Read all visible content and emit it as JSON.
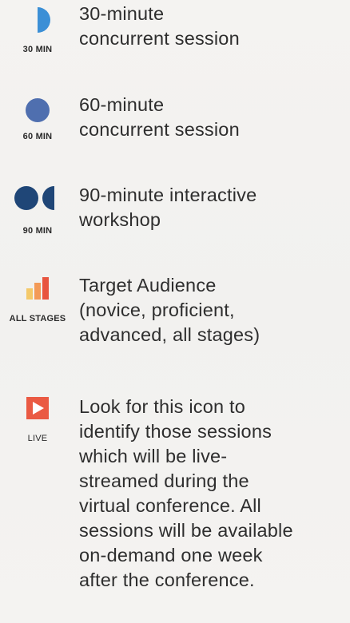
{
  "legend": {
    "session_30": {
      "icon": "half-circle-icon",
      "label": "30 MIN",
      "lines": [
        "30-minute",
        "concurrent session"
      ],
      "color": "#3b8fd6"
    },
    "session_60": {
      "icon": "circle-icon",
      "label": "60 MIN",
      "lines": [
        "60-minute",
        "concurrent session"
      ],
      "color": "#4f6faf"
    },
    "session_90": {
      "icon": "circle-and-half-circle-icon",
      "label": "90 MIN",
      "lines": [
        "90-minute interactive",
        "workshop"
      ],
      "color": "#1f4677"
    },
    "audience": {
      "icon": "audience-bars-icon",
      "label": "ALL STAGES",
      "lines": [
        "Target Audience",
        "(novice, proficient,",
        "advanced, all stages)"
      ],
      "colors": [
        "#f4c96a",
        "#f39a57",
        "#e8553f"
      ]
    },
    "live": {
      "icon": "play-icon",
      "label": "LIVE",
      "lines": [
        "Look for this icon to",
        "identify those sessions",
        "which will be live-",
        "streamed during the",
        "virtual conference. All",
        "sessions will be available",
        "on-demand one week",
        "after the conference."
      ],
      "color": "#ea5a43"
    }
  }
}
